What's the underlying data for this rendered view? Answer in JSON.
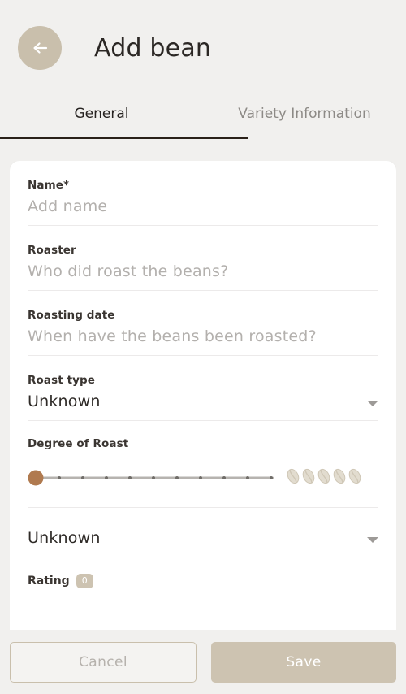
{
  "header": {
    "title": "Add bean",
    "back_icon": "arrow-left-icon"
  },
  "tabs": [
    {
      "label": "General",
      "active": true
    },
    {
      "label": "Variety Information",
      "active": false
    }
  ],
  "form": {
    "name": {
      "label": "Name*",
      "value": "",
      "placeholder": "Add name"
    },
    "roaster": {
      "label": "Roaster",
      "value": "",
      "placeholder": "Who did roast the beans?"
    },
    "roasting_date": {
      "label": "Roasting date",
      "value": "",
      "placeholder": "When have the beans been roasted?"
    },
    "roast_type": {
      "label": "Roast type",
      "value": "Unknown",
      "caret_icon": "chevron-down-icon"
    },
    "degree_of_roast": {
      "label": "Degree of Roast",
      "value": 0,
      "min": 0,
      "max": 10,
      "ticks": 11,
      "bean_count": 5,
      "bean_icon": "coffee-bean-icon"
    },
    "secondary_select": {
      "label": "",
      "value": "Unknown",
      "caret_icon": "chevron-down-icon"
    },
    "rating": {
      "label": "Rating",
      "value": "0"
    }
  },
  "footer": {
    "cancel_label": "Cancel",
    "save_label": "Save"
  },
  "colors": {
    "background": "#f1f0ee",
    "card": "#ffffff",
    "accent": "#cdc3b1",
    "back_button": "#c9bfac",
    "slider_thumb": "#b07a4f",
    "tab_underline": "#2a2119",
    "bean": "#ddd7ca"
  }
}
